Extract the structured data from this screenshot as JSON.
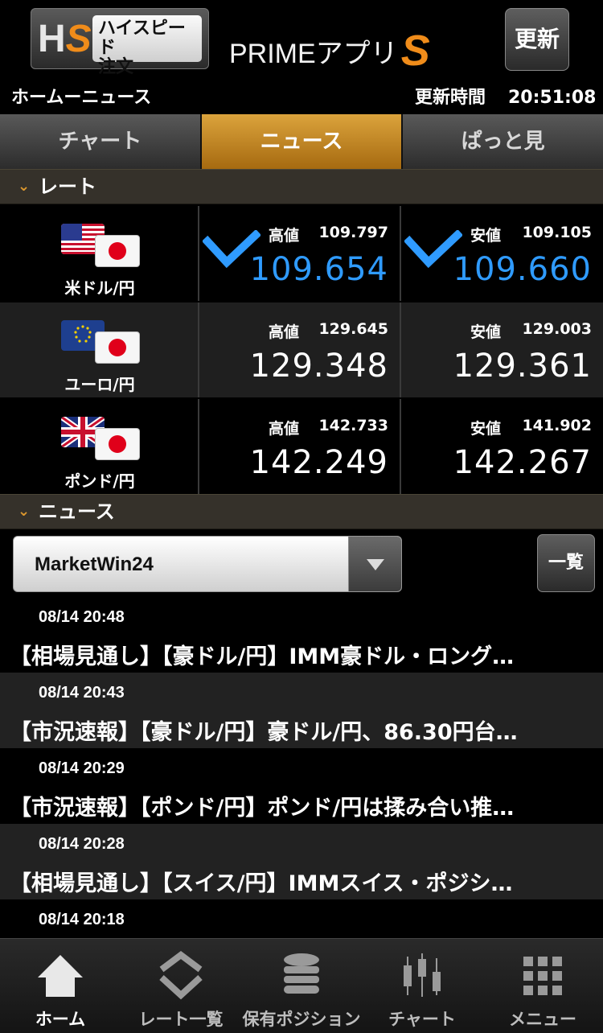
{
  "header": {
    "hs_logo_h": "H",
    "hs_logo_s": "S",
    "hs_label_line1": "ハイスピード",
    "hs_label_line2": "注文",
    "app_title": "PRIMEアプリ",
    "app_title_s": "S",
    "refresh_label": "更新"
  },
  "status": {
    "breadcrumb": "ホームーニュース",
    "update_label": "更新時間",
    "update_time": "20:51:08"
  },
  "tabs": [
    {
      "label": "チャート",
      "active": false
    },
    {
      "label": "ニュース",
      "active": true
    },
    {
      "label": "ぱっと見",
      "active": false
    }
  ],
  "rate_section": {
    "label": "レート"
  },
  "rates": [
    {
      "pair": "米ドル/円",
      "flag": "us-flag",
      "high_label": "高値",
      "high": "109.797",
      "low_label": "安値",
      "low": "109.105",
      "bid": "109.654",
      "ask": "109.660",
      "highlight": true,
      "highlight_color": "#2f9bff"
    },
    {
      "pair": "ユーロ/円",
      "flag": "eu-flag",
      "high_label": "高値",
      "high": "129.645",
      "low_label": "安値",
      "low": "129.003",
      "bid": "129.348",
      "ask": "129.361",
      "highlight": false
    },
    {
      "pair": "ポンド/円",
      "flag": "uk-flag",
      "high_label": "高値",
      "high": "142.733",
      "low_label": "安値",
      "low": "141.902",
      "bid": "142.249",
      "ask": "142.267",
      "highlight": false
    }
  ],
  "news_section": {
    "label": "ニュース"
  },
  "source": {
    "selected": "MarketWin24",
    "list_button": "一覧"
  },
  "news": [
    {
      "time": "08/14 20:48",
      "title": "【相場見通し】【豪ドル/円】IMM豪ドル・ロング…"
    },
    {
      "time": "08/14 20:43",
      "title": "【市況速報】【豪ドル/円】豪ドル/円、86.30円台…"
    },
    {
      "time": "08/14 20:29",
      "title": "【市況速報】【ポンド/円】ポンド/円は揉み合い推…"
    },
    {
      "time": "08/14 20:28",
      "title": "【相場見通し】【スイス/円】IMMスイス・ポジシ…"
    },
    {
      "time": "08/14 20:18",
      "title": ""
    }
  ],
  "nav": [
    {
      "label": "ホーム",
      "icon": "home-icon",
      "active": true
    },
    {
      "label": "レート一覧",
      "icon": "rate-list-icon",
      "active": false
    },
    {
      "label": "保有ポジション",
      "icon": "positions-icon",
      "active": false
    },
    {
      "label": "チャート",
      "icon": "chart-icon",
      "active": false
    },
    {
      "label": "メニュー",
      "icon": "menu-grid-icon",
      "active": false
    }
  ],
  "colors": {
    "accent": "#f08c1a",
    "active_tab": "#c2862a",
    "price_highlight": "#2f9bff",
    "section_bg": "#35312a"
  }
}
